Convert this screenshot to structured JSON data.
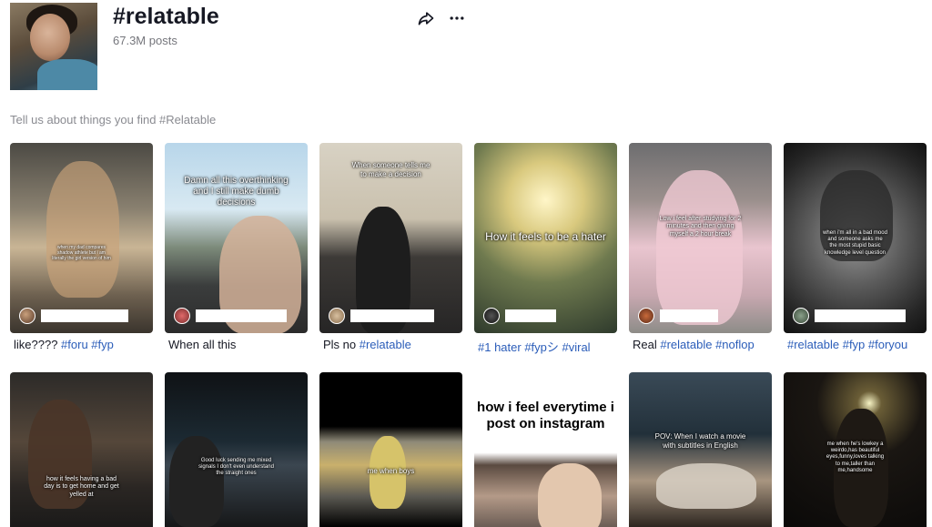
{
  "header": {
    "title": "#relatable",
    "post_count": "67.3M posts",
    "avatar_icon": "profile-avatar",
    "share_icon": "share-arrow-icon",
    "more_icon": "ellipsis-icon"
  },
  "prompt": "Tell us about things you find #Relatable",
  "colors": {
    "text": "#161823",
    "muted": "#75767c",
    "hashtag": "#2b5db9"
  },
  "row1": [
    {
      "overlay": "when my dad compares\nshadow athlete but i am\nliterally the girl version of him",
      "caption_plain": "like???? ",
      "caption_tags": "#foru #fyp"
    },
    {
      "overlay": "Damn all this overthinking\nand I still make dumb\ndecisions",
      "caption_plain": "When all this",
      "caption_tags": ""
    },
    {
      "overlay": "When someone tells me\nto make a decision",
      "caption_plain": "Pls no ",
      "caption_tags": "#relatable"
    },
    {
      "overlay": "How it feels to be a hater",
      "caption_plain": "",
      "caption_tags": "#1 hater #fypシ #viral"
    },
    {
      "overlay": "Low i feel after studying for 2\nminutes and then giving\nmyself a 2 hour break",
      "caption_plain": "Real ",
      "caption_tags": "#relatable #noflop"
    },
    {
      "overlay": "when i'm all in a bad mood\nand someone asks me\nthe most stupid basic\nknowledge level question",
      "caption_plain": "",
      "caption_tags": "#relatable #fyp #foryou"
    }
  ],
  "row2": [
    {
      "overlay": "how it feels having a bad\nday is to get home and get\nyelled at"
    },
    {
      "overlay": "Good luck sending me mixed\nsignals I don't even understand\nthe straight ones"
    },
    {
      "overlay": "me when boys"
    },
    {
      "overlay": "how i feel everytime i\npost on instagram"
    },
    {
      "overlay": "POV: When I watch a movie\nwith subtitles in English"
    },
    {
      "overlay": "me when he's lowkey a\nweirdo,has beautiful\neyes,funny,loves talking\nto me,taller than\nme,handsome"
    }
  ]
}
